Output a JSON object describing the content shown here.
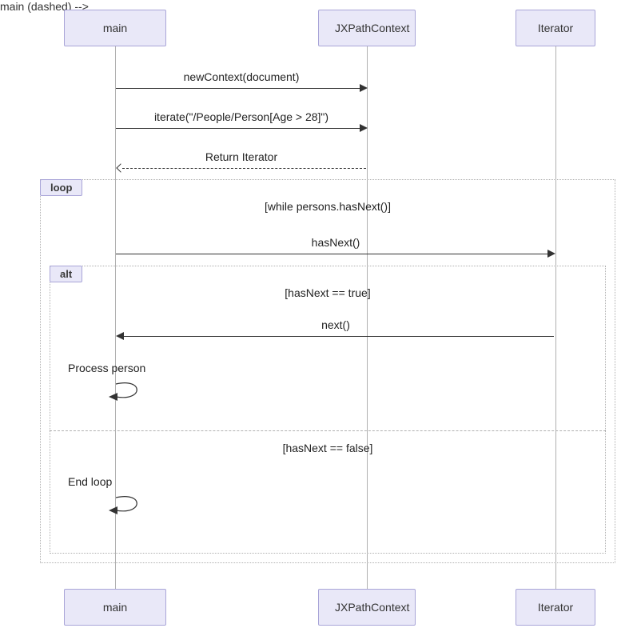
{
  "participants": {
    "p1": "main",
    "p2": "JXPathContext",
    "p3": "Iterator"
  },
  "messages": {
    "m1": "newContext(document)",
    "m2": "iterate(\"/People/Person[Age > 28]\")",
    "m3": "Return Iterator",
    "m4": "hasNext()",
    "m5": "next()",
    "m6": "Process person",
    "m7": "End loop"
  },
  "fragments": {
    "loop_label": "loop",
    "loop_cond": "[while persons.hasNext()]",
    "alt_label": "alt",
    "alt_cond_true": "[hasNext == true]",
    "alt_cond_false": "[hasNext == false]"
  }
}
